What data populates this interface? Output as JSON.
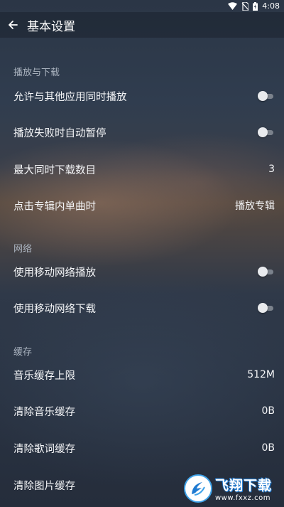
{
  "status_bar": {
    "time": "4:08"
  },
  "header": {
    "title": "基本设置"
  },
  "sections": [
    {
      "title": "播放与下载",
      "items": [
        {
          "label": "允许与其他应用同时播放",
          "type": "toggle",
          "on": false
        },
        {
          "label": "播放失败时自动暂停",
          "type": "toggle",
          "on": false
        },
        {
          "label": "最大同时下载数目",
          "type": "value",
          "value": "3"
        },
        {
          "label": "点击专辑内单曲时",
          "type": "value",
          "value": "播放专辑"
        }
      ]
    },
    {
      "title": "网络",
      "items": [
        {
          "label": "使用移动网络播放",
          "type": "toggle",
          "on": false
        },
        {
          "label": "使用移动网络下载",
          "type": "toggle",
          "on": false
        }
      ]
    },
    {
      "title": "缓存",
      "items": [
        {
          "label": "音乐缓存上限",
          "type": "value",
          "value": "512M"
        },
        {
          "label": "清除音乐缓存",
          "type": "value",
          "value": "0B"
        },
        {
          "label": "清除歌词缓存",
          "type": "value",
          "value": "0B"
        },
        {
          "label": "清除图片缓存",
          "type": "value",
          "value": ""
        }
      ]
    }
  ],
  "watermark": {
    "title": "飞翔下载",
    "url": "www.fxxz.com"
  },
  "colors": {
    "toggle_off_track": "#7b828c",
    "toggle_off_thumb": "#e9ebee",
    "watermark_blue": "#1f7ad1"
  }
}
